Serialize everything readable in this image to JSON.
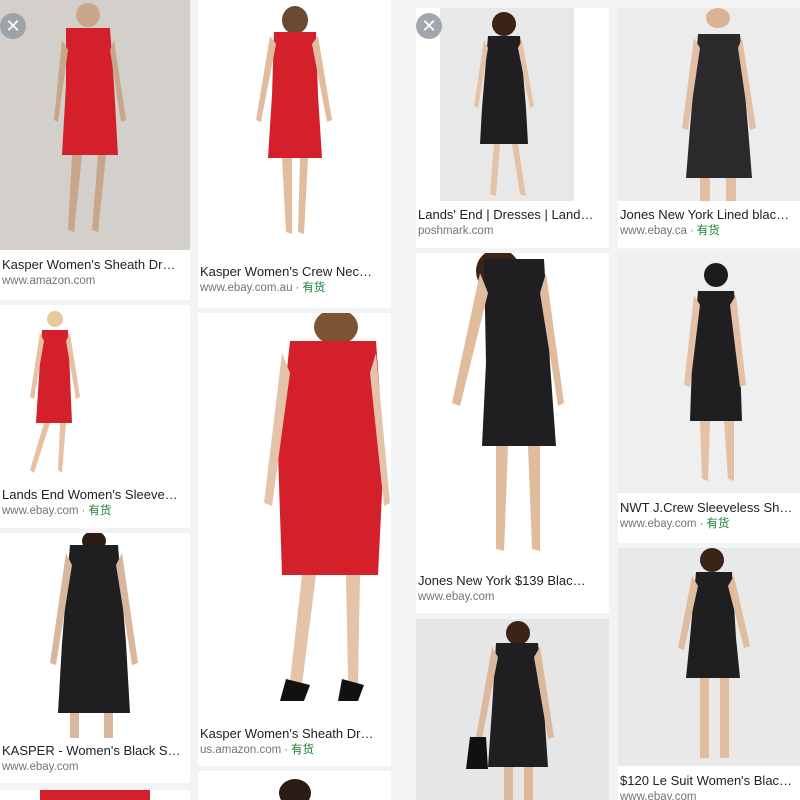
{
  "results": [
    {
      "id": "r1",
      "title": "Kasper Women's Sheath Dr…",
      "source": "www.amazon.com",
      "stock": ""
    },
    {
      "id": "r2",
      "title": "Kasper Women's Crew Nec…",
      "source": "www.ebay.com.au",
      "stock": "有货"
    },
    {
      "id": "r3",
      "title": "Lands' End | Dresses | Land…",
      "source": "poshmark.com",
      "stock": ""
    },
    {
      "id": "r4",
      "title": "Jones New York Lined blac…",
      "source": "www.ebay.ca",
      "stock": "有货"
    },
    {
      "id": "r5",
      "title": "Lands End Women's Sleeve…",
      "source": "www.ebay.com",
      "stock": "有货"
    },
    {
      "id": "r6",
      "title": "Kasper Women's Sheath Dr…",
      "source": "us.amazon.com",
      "stock": "有货"
    },
    {
      "id": "r7",
      "title": "Jones New York $139 Blac…",
      "source": "www.ebay.com",
      "stock": ""
    },
    {
      "id": "r8",
      "title": "NWT J.Crew Sleeveless She…",
      "source": "www.ebay.com",
      "stock": "有货"
    },
    {
      "id": "r9",
      "title": "KASPER - Women's Black S…",
      "source": "www.ebay.com",
      "stock": ""
    },
    {
      "id": "r10",
      "title": "$120 Le Suit Women's Blac…",
      "source": "www.ebay.com",
      "stock": ""
    }
  ],
  "icons": {
    "close": "close-icon",
    "dress": "dress-image"
  },
  "glyphs": {
    "close": "✕",
    "dot": "·"
  },
  "colors": {
    "red_dress": "#d4202a",
    "black_dress": "#1f1f21",
    "stock_green": "#188038",
    "source_gray": "#70757a"
  }
}
